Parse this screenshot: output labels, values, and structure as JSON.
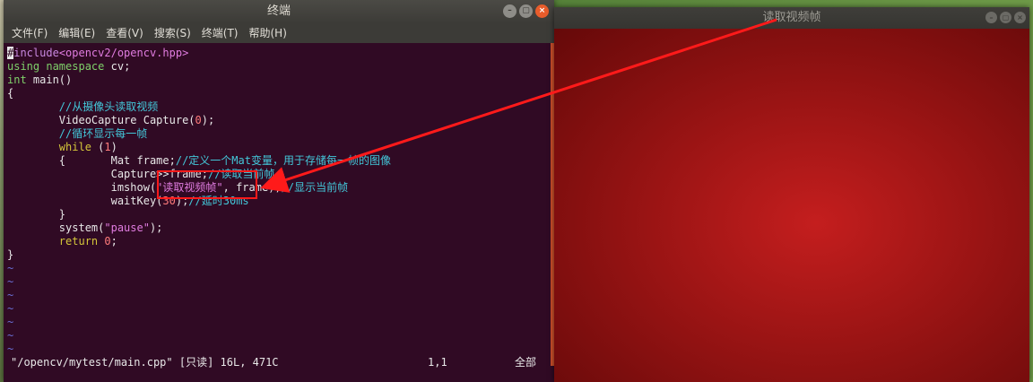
{
  "terminal": {
    "title": "终端",
    "menu": [
      "文件(F)",
      "编辑(E)",
      "查看(V)",
      "搜索(S)",
      "终端(T)",
      "帮助(H)"
    ],
    "buttons": {
      "minimize": "–",
      "maximize": "▢",
      "close": "×"
    },
    "code": {
      "l1_a": "#",
      "l1_b": "include",
      "l1_c": "<opencv2/opencv.hpp>",
      "l2_a": "using",
      "l2_b": "namespace",
      "l2_c": " cv;",
      "l3_a": "int",
      "l3_b": " main()",
      "l4": "{",
      "l5": "        //从摄像头读取视频",
      "l6_a": "        VideoCapture Capture(",
      "l6_b": "0",
      "l6_c": ");",
      "l7": "        //循环显示每一帧",
      "l8_a": "        ",
      "l8_b": "while",
      "l8_c": " (",
      "l8_d": "1",
      "l8_e": ")",
      "l9_a": "        {       Mat frame;",
      "l9_b": "//定义一个Mat变量，用于存储每一帧的图像",
      "l10_a": "                Capture>>frame;",
      "l10_b": "//读取当前帧",
      "l11_a": "                imshow(",
      "l11_b": "\"读取视频帧\"",
      "l11_c": ", frame);",
      "l11_d": "//显示当前帧",
      "l12_a": "                waitKey(",
      "l12_b": "30",
      "l12_c": ");",
      "l12_d": "//延时30ms",
      "l13": "        }",
      "l14_a": "        system(",
      "l14_b": "\"pause\"",
      "l14_c": ");",
      "l15_a": "        ",
      "l15_b": "return",
      "l15_c": " ",
      "l15_d": "0",
      "l15_e": ";",
      "l16": "}",
      "tilde": "~"
    },
    "status": {
      "file": "\"/opencv/mytest/main.cpp\" [只读] 16L, 471C",
      "position": "1,1",
      "scroll": "全部"
    }
  },
  "video_window": {
    "title": "读取视频帧",
    "buttons": {
      "minimize": "–",
      "maximize": "▢",
      "close": "×"
    }
  },
  "colors": {
    "terminal_bg": "#300a24",
    "video_frame": "#9a1414",
    "annotation": "#ff1a1a"
  }
}
